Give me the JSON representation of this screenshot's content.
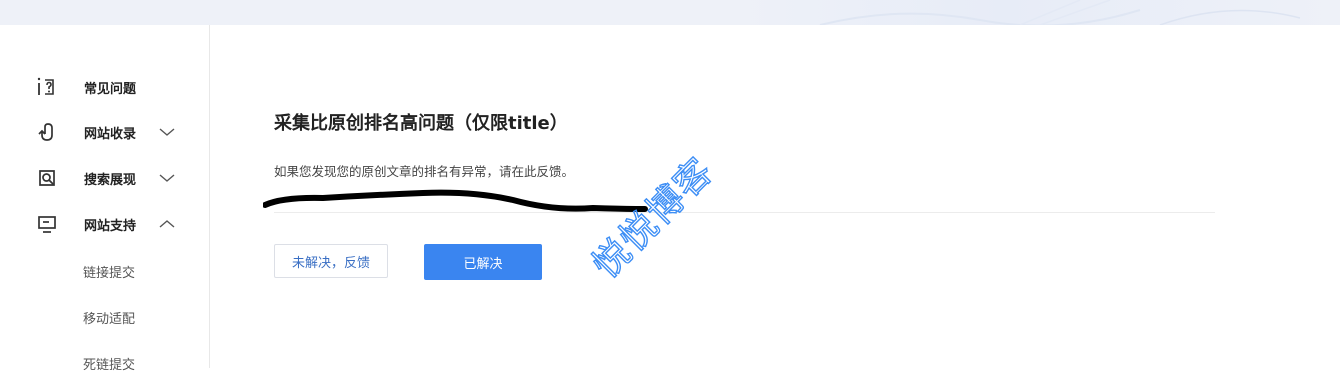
{
  "sidebar": {
    "items": [
      {
        "label": "常见问题",
        "icon": "faq-icon",
        "expandable": false
      },
      {
        "label": "网站收录",
        "icon": "index-icon",
        "expandable": true,
        "expanded": false
      },
      {
        "label": "搜索展现",
        "icon": "search-display-icon",
        "expandable": true,
        "expanded": false
      },
      {
        "label": "网站支持",
        "icon": "site-support-icon",
        "expandable": true,
        "expanded": true
      }
    ],
    "subitems": [
      "链接提交",
      "移动适配",
      "死链提交"
    ]
  },
  "main": {
    "title": "采集比原创排名高问题（仅限title）",
    "description": "如果您发现您的原创文章的排名有异常，请在此反馈。",
    "buttons": {
      "unresolved": "未解决，反馈",
      "resolved": "已解决"
    }
  },
  "watermark": "悦悦博客",
  "colors": {
    "primary": "#3a85f0",
    "watermark": "#3d8ef5",
    "banner": "#eef1f8"
  }
}
